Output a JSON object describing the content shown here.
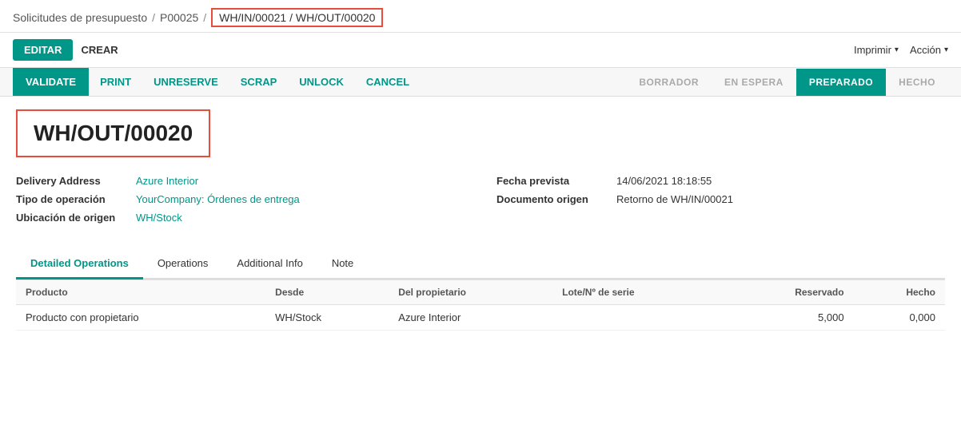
{
  "breadcrumb": {
    "items": [
      {
        "label": "Solicitudes de presupuesto",
        "link": true
      },
      {
        "label": "P00025",
        "link": true
      },
      {
        "label": "WH/IN/00021 / WH/OUT/00020",
        "link": false,
        "highlighted": true
      }
    ],
    "separator": "/"
  },
  "top_actions": {
    "edit_label": "EDITAR",
    "create_label": "CREAR",
    "print_label": "Imprimir",
    "action_label": "Acción"
  },
  "workflow": {
    "validate_label": "VALIDATE",
    "buttons": [
      "PRINT",
      "UNRESERVE",
      "SCRAP",
      "UNLOCK",
      "CANCEL"
    ]
  },
  "status_bar": {
    "items": [
      {
        "label": "BORRADOR",
        "active": false
      },
      {
        "label": "EN ESPERA",
        "active": false
      },
      {
        "label": "PREPARADO",
        "active": true
      },
      {
        "label": "HECHO",
        "active": false
      }
    ]
  },
  "document": {
    "title": "WH/OUT/00020"
  },
  "fields_left": [
    {
      "label": "Delivery Address",
      "value": "Azure Interior",
      "link": true
    },
    {
      "label": "Tipo de operación",
      "value": "YourCompany: Órdenes de entrega",
      "link": true
    },
    {
      "label": "Ubicación de origen",
      "value": "WH/Stock",
      "link": true
    }
  ],
  "fields_right": [
    {
      "label": "Fecha prevista",
      "value": "14/06/2021 18:18:55",
      "link": false
    },
    {
      "label": "Documento origen",
      "value": "Retorno de WH/IN/00021",
      "link": false
    }
  ],
  "tabs": [
    {
      "label": "Detailed Operations",
      "active": true
    },
    {
      "label": "Operations",
      "active": false
    },
    {
      "label": "Additional Info",
      "active": false
    },
    {
      "label": "Note",
      "active": false
    }
  ],
  "table": {
    "columns": [
      {
        "label": "Producto",
        "align": "left"
      },
      {
        "label": "Desde",
        "align": "left"
      },
      {
        "label": "Del propietario",
        "align": "left"
      },
      {
        "label": "Lote/Nº de serie",
        "align": "left"
      },
      {
        "label": "Reservado",
        "align": "right"
      },
      {
        "label": "Hecho",
        "align": "right"
      }
    ],
    "rows": [
      {
        "producto": "Producto con propietario",
        "desde": "WH/Stock",
        "del_propietario": "Azure Interior",
        "lote": "",
        "reservado": "5,000",
        "hecho": "0,000"
      }
    ]
  }
}
